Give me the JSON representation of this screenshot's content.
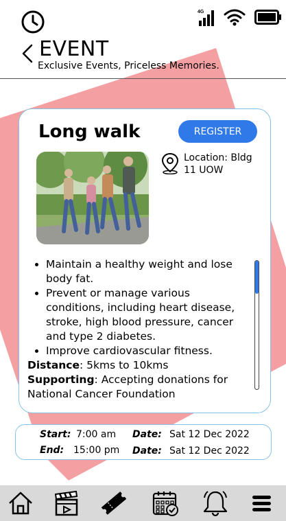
{
  "header": {
    "title": "EVENT",
    "subtitle": "Exclusive Events, Priceless Memories."
  },
  "status_bar": {
    "network": "4G"
  },
  "event": {
    "name": "Long walk",
    "register_label": "REGISTER",
    "location": "Location: Bldg 11 UOW",
    "benefits": [
      "Maintain a healthy weight and lose body fat.",
      "Prevent or manage various conditions, including heart disease, stroke, high blood pressure, cancer and type 2 diabetes.",
      "Improve cardiovascular fitness."
    ],
    "distance_label": "Distance",
    "distance_value": ": 5kms to 10kms",
    "supporting_label": "Supporting",
    "supporting_value": ": Accepting donations for National Cancer Foundation"
  },
  "schedule": {
    "start_label": "Start:",
    "start_time": "7:00 am",
    "end_label": "End:",
    "end_time": "15:00 pm",
    "date_label": "Date:",
    "start_date": "Sat 12 Dec 2022",
    "end_date": "Sat 12 Dec 2022"
  },
  "nav": {
    "items": [
      "home-icon",
      "movie-clapper-icon",
      "ticket-icon",
      "calendar-check-icon",
      "bell-icon",
      "menu-icon"
    ],
    "active": "ticket-icon"
  },
  "colors": {
    "accent": "#2f79e8",
    "pink": "#f4a0a3",
    "card_border": "#86c2e6",
    "nav_bg": "#d9d9d9"
  }
}
